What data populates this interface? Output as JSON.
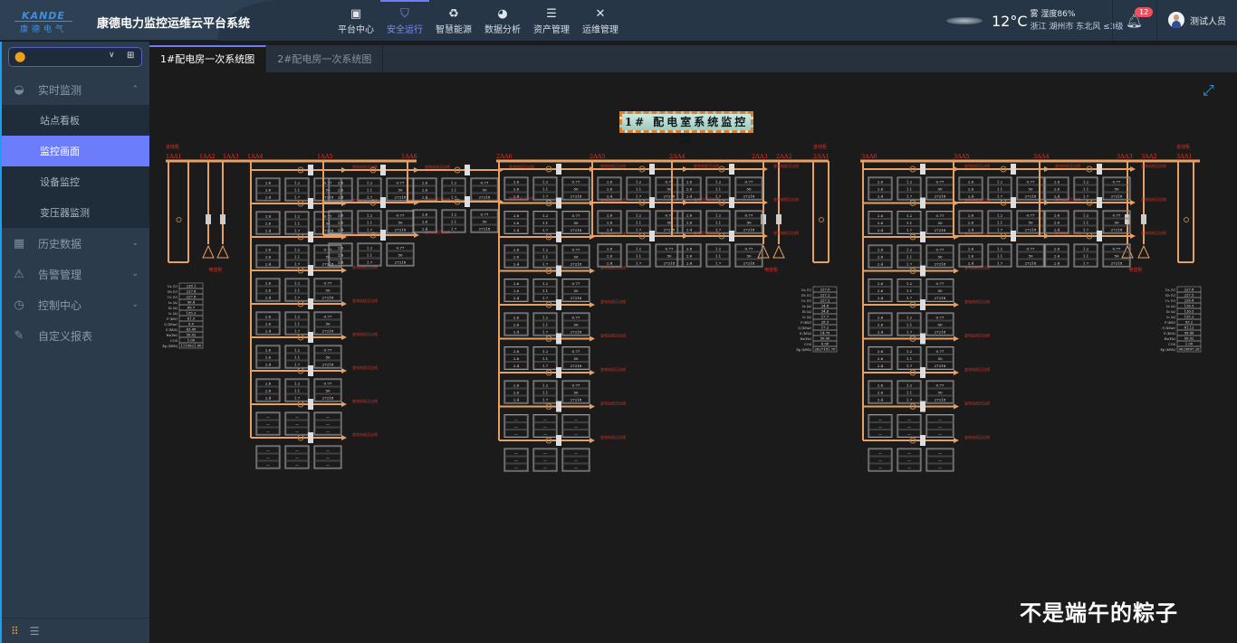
{
  "header": {
    "logo_en": "KANDE",
    "logo_cn": "康德电气",
    "app_title": "康德电力监控运维云平台系统",
    "nav": [
      {
        "label": "平台中心",
        "icon": "monitor-icon"
      },
      {
        "label": "安全运行",
        "icon": "shield-icon",
        "active": true
      },
      {
        "label": "智慧能源",
        "icon": "recycle-icon"
      },
      {
        "label": "数据分析",
        "icon": "pie-chart-icon"
      },
      {
        "label": "资产管理",
        "icon": "database-icon"
      },
      {
        "label": "运维管理",
        "icon": "tools-icon"
      }
    ],
    "weather": {
      "temp": "12°C",
      "condition": "雾",
      "humidity": "湿度86%",
      "location": "浙江  湖州市  东北风 ≤3级"
    },
    "notifications": "12",
    "user": "测试人员"
  },
  "sidebar": {
    "station_value": "",
    "menu": [
      {
        "label": "实时监测",
        "icon": "gauge-icon",
        "expanded": true,
        "children": [
          "站点看板",
          "监控画面",
          "设备监控",
          "变压器监测"
        ]
      },
      {
        "label": "历史数据",
        "icon": "calendar-icon"
      },
      {
        "label": "告警管理",
        "icon": "alarm-icon"
      },
      {
        "label": "控制中心",
        "icon": "clock-icon"
      },
      {
        "label": "自定义报表",
        "icon": "report-icon"
      }
    ],
    "active_child": "监控画面"
  },
  "tabs": [
    "1#配电房一次系统图",
    "2#配电房一次系统图"
  ],
  "diagram": {
    "title": "1# 配电室系统监控图",
    "incoming_label": "进线柜",
    "capacitor_label": "电容柜",
    "feeder_label": "变电站低压出线",
    "colors": {
      "bus": "#e8a062",
      "label": "#d9342b",
      "box": "#9a9a9a",
      "text": "#e6e6e6"
    },
    "sections": [
      {
        "labels": [
          "1AA1",
          "1AA2",
          "1AA3",
          "1AA4",
          "1AA5",
          "1AA6"
        ],
        "meter": {
          "rows": [
            "Ua (V)",
            "Ub (V)",
            "Uc (V)",
            "Ia (A)",
            "Ib (A)",
            "Ic (A)",
            "P (kW)",
            "Q (kVar)",
            "S (kVA)",
            "Hz(Hz)",
            "COS",
            "Ep (kWh)"
          ],
          "values": [
            "228.1",
            "227.6",
            "227.8",
            "90.4",
            "89.7",
            "155.2",
            "61.3",
            "0.0",
            "63.00",
            "50.02",
            "1.00",
            "1110621.00"
          ]
        }
      },
      {
        "labels": [
          "2AA6",
          "2AA5",
          "2AA4",
          "2AA3",
          "2AA2",
          "2AA1"
        ],
        "meter": {
          "rows": [
            "Ua (V)",
            "Ub (V)",
            "Uc (V)",
            "Ia (A)",
            "Ib (A)",
            "Ic (A)",
            "P (kW)",
            "Q (kVar)",
            "S (kVA)",
            "Hz(Hz)",
            "COS",
            "Ep (kWh)"
          ],
          "values": [
            "227.0",
            "227.2",
            "227.2",
            "24.8",
            "34.6",
            "17.7",
            "28.3",
            "17.2",
            "14.70",
            "50.00",
            "0.90",
            "2627181.70"
          ]
        }
      },
      {
        "labels": [
          "3AA6",
          "3AA5",
          "3AA4",
          "3AA3",
          "3AA2",
          "3AA1"
        ],
        "meter": {
          "rows": [
            "Ua (V)",
            "Ub (V)",
            "Uc (V)",
            "Ia (A)",
            "Ib (A)",
            "Ic (A)",
            "P (kW)",
            "Q (kVar)",
            "S (kVA)",
            "Hz(Hz)",
            "COS",
            "Ep (kWh)"
          ],
          "values": [
            "227.8",
            "227.5",
            "226.8",
            "126.3",
            "126.5",
            "135.2",
            "93.2",
            "81.12",
            "99.40",
            "50.02",
            "1.00",
            "9025897.20"
          ]
        }
      }
    ],
    "feeder_values": [
      [
        "2.6",
        "2.6",
        "2.4"
      ],
      [
        "1.2",
        "1.1",
        "1.7"
      ],
      [
        "0.77",
        "50",
        "27218"
      ]
    ]
  },
  "watermark": "不是端午的粽子"
}
